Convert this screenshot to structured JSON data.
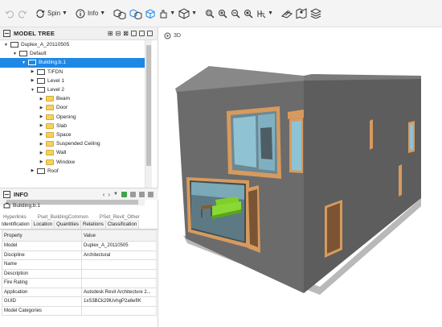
{
  "toolbar": {
    "spin_label": "Spin",
    "info_label": "Info"
  },
  "model_tree": {
    "title": "MODEL TREE",
    "items": [
      {
        "label": "Duplex_A_20110505",
        "depth": 0,
        "expanded": true
      },
      {
        "label": "Default",
        "depth": 1,
        "expanded": true
      },
      {
        "label": "Building.b.1",
        "depth": 2,
        "expanded": true,
        "selected": true
      },
      {
        "label": "T/FDN",
        "depth": 3
      },
      {
        "label": "Level 1",
        "depth": 3
      },
      {
        "label": "Level 2",
        "depth": 3,
        "expanded": true
      },
      {
        "label": "Beam",
        "depth": 4
      },
      {
        "label": "Door",
        "depth": 4
      },
      {
        "label": "Opening",
        "depth": 4
      },
      {
        "label": "Slab",
        "depth": 4
      },
      {
        "label": "Space",
        "depth": 4
      },
      {
        "label": "Suspended Ceiling",
        "depth": 4
      },
      {
        "label": "Wall",
        "depth": 4
      },
      {
        "label": "Window",
        "depth": 4
      },
      {
        "label": "Roof",
        "depth": 3
      }
    ]
  },
  "info": {
    "title": "INFO",
    "selected_object": "Building.b.1",
    "upper_tabs": [
      "Hyperlinks",
      "Pset_BuildingCommon",
      "PSet_Revit_Other"
    ],
    "tabs": [
      "Identification",
      "Location",
      "Quantities",
      "Relations",
      "Classification"
    ],
    "columns": [
      "Property",
      "Value"
    ],
    "rows": [
      [
        "Model",
        "Duplex_A_20110505"
      ],
      [
        "Discipline",
        "Architectural"
      ],
      [
        "Name",
        ""
      ],
      [
        "Description",
        ""
      ],
      [
        "Fire Rating",
        ""
      ],
      [
        "Application",
        "Autodesk Revit Architecture 2..."
      ],
      [
        "GUID",
        "1xS3BCk29lUvhgP2a6efIK"
      ],
      [
        "Model Categories",
        ""
      ]
    ]
  },
  "viewport": {
    "tab_label": "3D"
  },
  "colors": {
    "selection": "#1e88e5",
    "wall_front": "#6a6a6a",
    "wall_side": "#5a5a5a",
    "roof": "#858585",
    "glass": "#8fc3d4",
    "frame": "#d79a5e",
    "sofa": "#7fcf28"
  }
}
